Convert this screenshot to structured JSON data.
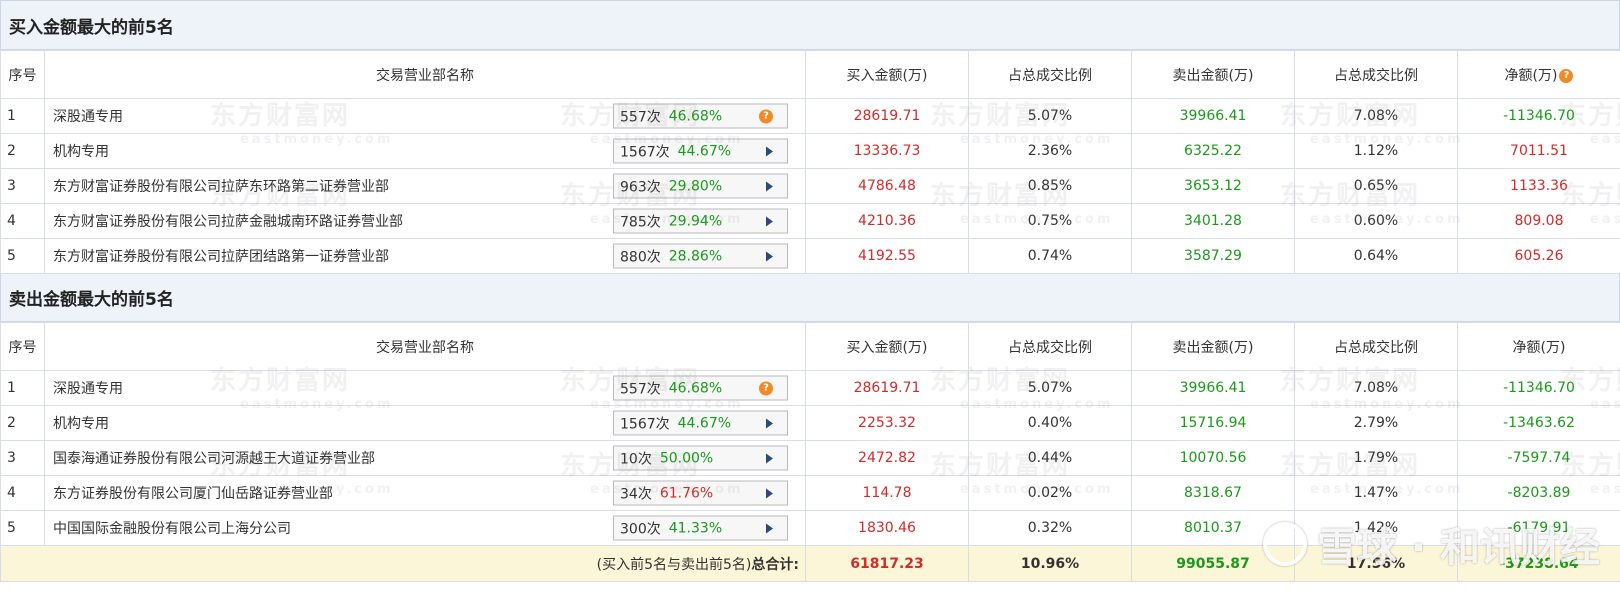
{
  "buy_section": {
    "title": "买入金额最大的前5名",
    "headers": {
      "idx": "序号",
      "name": "交易营业部名称",
      "buy": "买入金额(万)",
      "buy_ratio": "占总成交比例",
      "sell": "卖出金额(万)",
      "sell_ratio": "占总成交比例",
      "net": "净额(万)"
    },
    "rows": [
      {
        "idx": "1",
        "name": "深股通专用",
        "times": "557次",
        "pct": "46.68%",
        "buy": "28619.71",
        "buy_ratio": "5.07%",
        "sell": "39966.41",
        "sell_ratio": "7.08%",
        "net": "-11346.70"
      },
      {
        "idx": "2",
        "name": "机构专用",
        "times": "1567次",
        "pct": "44.67%",
        "buy": "13336.73",
        "buy_ratio": "2.36%",
        "sell": "6325.22",
        "sell_ratio": "1.12%",
        "net": "7011.51"
      },
      {
        "idx": "3",
        "name": "东方财富证券股份有限公司拉萨东环路第二证券营业部",
        "times": "963次",
        "pct": "29.80%",
        "buy": "4786.48",
        "buy_ratio": "0.85%",
        "sell": "3653.12",
        "sell_ratio": "0.65%",
        "net": "1133.36"
      },
      {
        "idx": "4",
        "name": "东方财富证券股份有限公司拉萨金融城南环路证券营业部",
        "times": "785次",
        "pct": "29.94%",
        "buy": "4210.36",
        "buy_ratio": "0.75%",
        "sell": "3401.28",
        "sell_ratio": "0.60%",
        "net": "809.08"
      },
      {
        "idx": "5",
        "name": "东方财富证券股份有限公司拉萨团结路第一证券营业部",
        "times": "880次",
        "pct": "28.86%",
        "buy": "4192.55",
        "buy_ratio": "0.74%",
        "sell": "3587.29",
        "sell_ratio": "0.64%",
        "net": "605.26"
      }
    ]
  },
  "sell_section": {
    "title": "卖出金额最大的前5名",
    "headers": {
      "idx": "序号",
      "name": "交易营业部名称",
      "buy": "买入金额(万)",
      "buy_ratio": "占总成交比例",
      "sell": "卖出金额(万)",
      "sell_ratio": "占总成交比例",
      "net": "净额(万)"
    },
    "rows": [
      {
        "idx": "1",
        "name": "深股通专用",
        "times": "557次",
        "pct": "46.68%",
        "buy": "28619.71",
        "buy_ratio": "5.07%",
        "sell": "39966.41",
        "sell_ratio": "7.08%",
        "net": "-11346.70"
      },
      {
        "idx": "2",
        "name": "机构专用",
        "times": "1567次",
        "pct": "44.67%",
        "buy": "2253.32",
        "buy_ratio": "0.40%",
        "sell": "15716.94",
        "sell_ratio": "2.79%",
        "net": "-13463.62"
      },
      {
        "idx": "3",
        "name": "国泰海通证券股份有限公司河源越王大道证券营业部",
        "times": "10次",
        "pct": "50.00%",
        "buy": "2472.82",
        "buy_ratio": "0.44%",
        "sell": "10070.56",
        "sell_ratio": "1.79%",
        "net": "-7597.74"
      },
      {
        "idx": "4",
        "name": "东方证券股份有限公司厦门仙岳路证券营业部",
        "times": "34次",
        "pct": "61.76%",
        "buy": "114.78",
        "buy_ratio": "0.02%",
        "sell": "8318.67",
        "sell_ratio": "1.47%",
        "net": "-8203.89"
      },
      {
        "idx": "5",
        "name": "中国国际金融股份有限公司上海分公司",
        "times": "300次",
        "pct": "41.33%",
        "buy": "1830.46",
        "buy_ratio": "0.32%",
        "sell": "8010.37",
        "sell_ratio": "1.42%",
        "net": "-6179.91"
      }
    ]
  },
  "total": {
    "label_paren": "(买入前5名与卖出前5名)",
    "label_main": "总合计:",
    "buy": "61817.23",
    "buy_ratio": "10.96%",
    "sell": "99055.87",
    "sell_ratio": "17.56%",
    "net": "-37238.64"
  },
  "watermark": {
    "cn": "东方财富网",
    "en": "eastmoney.com",
    "xueqiu": "雪球 · 和讯财经"
  },
  "colors": {
    "positive": "#d42a2a",
    "negative": "#1a9a1a",
    "header_bg": "#eef3f9",
    "total_bg": "#fcf6d9",
    "help_icon": "#f08a24"
  }
}
